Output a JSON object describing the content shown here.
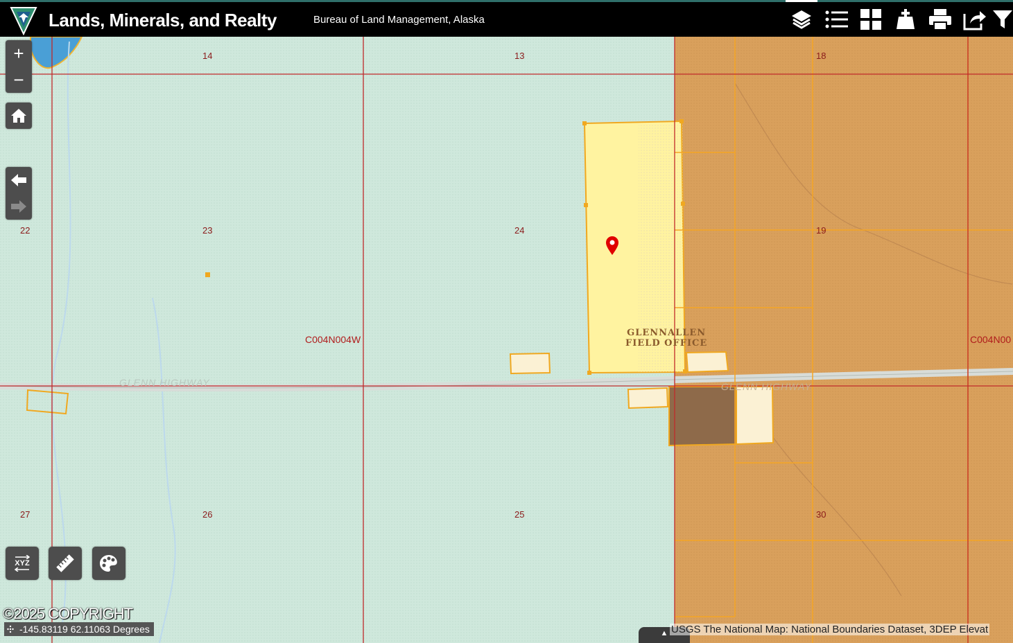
{
  "header": {
    "title": "Lands, Minerals, and Realty",
    "subtitle": "Bureau of Land Management, Alaska",
    "tools": [
      "layers-icon",
      "legend-list-icon",
      "basemap-gallery-icon",
      "add-data-icon",
      "print-icon",
      "share-icon",
      "filter-icon"
    ]
  },
  "map": {
    "sections": {
      "s14": "14",
      "s13": "13",
      "s18": "18",
      "s22": "22",
      "s23": "23",
      "s24": "24",
      "s19": "19",
      "s27": "27",
      "s26": "26",
      "s25": "25",
      "s30": "30"
    },
    "townships": {
      "west": "C004N004W",
      "east": "C004N00"
    },
    "road": {
      "west": "GLENN HIGHWAY",
      "east": "GLENN HIGHWAY"
    },
    "field_office": {
      "line1": "GLENNALLEN",
      "line2": "FIELD OFFICE"
    },
    "colors": {
      "federal_land": "#cfe8dc",
      "native_land": "#d9a05c",
      "selected_parcel": "#fff3a0",
      "section_line": "#c0292b",
      "marker": "#e00000"
    }
  },
  "controls": {
    "zoom_in": "+",
    "zoom_out": "−",
    "home": "home-icon",
    "back": "arrow-left-icon",
    "forward": "arrow-right-icon",
    "xyz_label": "XYZ",
    "measure": "ruler-icon",
    "draw": "palette-icon"
  },
  "footer": {
    "copyright": "©2025 COPYRIGHT",
    "coordinates": "-145.83119 62.11063 Degrees",
    "attribution": "USGS The National Map: National Boundaries Dataset, 3DEP Elevat"
  }
}
